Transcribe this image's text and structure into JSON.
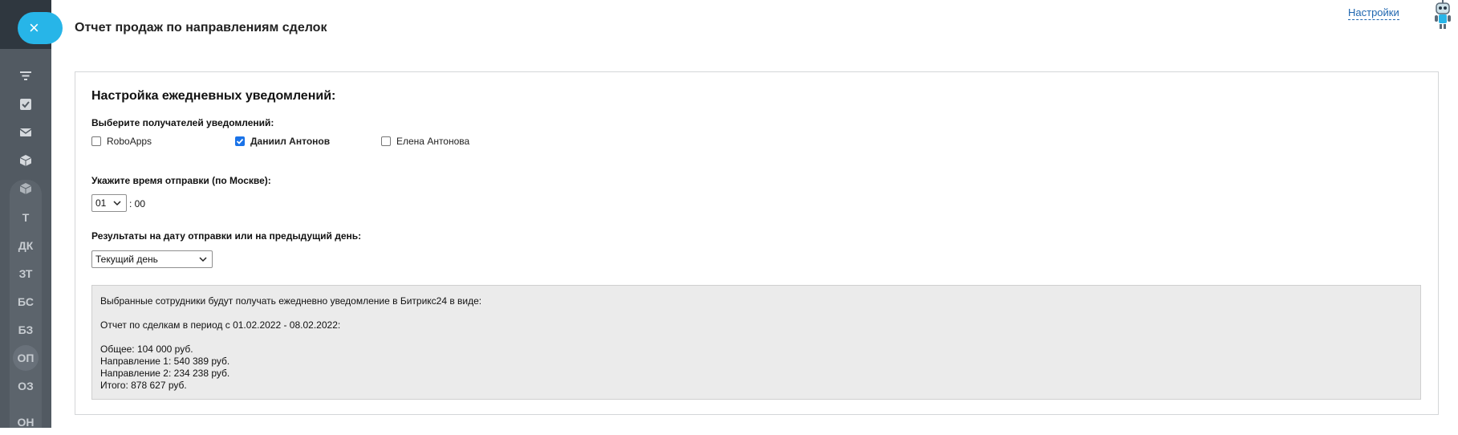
{
  "sidebar": {
    "close_label": "×",
    "items": [
      {
        "icon": "filter-icon"
      },
      {
        "icon": "checkbox-icon"
      },
      {
        "icon": "mail-icon"
      },
      {
        "icon": "box-icon"
      },
      {
        "icon": "box-icon"
      },
      {
        "label": "Т"
      },
      {
        "label": "ДК"
      },
      {
        "label": "ЗТ"
      },
      {
        "label": "БС"
      },
      {
        "label": "БЗ"
      },
      {
        "label": "ОП"
      },
      {
        "label": "ОЗ"
      },
      {
        "label": "ОН"
      }
    ]
  },
  "header": {
    "title": "Отчет продаж по направлениям сделок",
    "settings_link": "Настройки"
  },
  "form": {
    "section_title": "Настройка ежедневных уведомлений:",
    "recipients_label": "Выберите получателей уведомлений:",
    "recipients": [
      {
        "name": "RoboApps",
        "checked": false
      },
      {
        "name": "Даниил Антонов",
        "checked": true
      },
      {
        "name": "Елена Антонова",
        "checked": false
      }
    ],
    "time_label": "Укажите время отправки (по Москве):",
    "hour_value": "01",
    "minutes_value": ": 00",
    "date_label": "Результаты на дату отправки или на предыдущий день:",
    "date_value": "Текущий день"
  },
  "preview": {
    "intro": "Выбранные сотрудники будут получать ежедневно уведомление в Битрикс24 в виде:",
    "period": "Отчет по сделкам в период с 01.02.2022 - 08.02.2022:",
    "lines": [
      "Общее: 104 000 руб.",
      "Направление 1: 540 389 руб.",
      "Направление 2: 234 238 руб.",
      "Итого: 878 627 руб."
    ]
  },
  "colors": {
    "accent": "#27b5e8",
    "sidebar": "#525a62",
    "link": "#2067b0",
    "checkbox": "#1a73e8"
  }
}
